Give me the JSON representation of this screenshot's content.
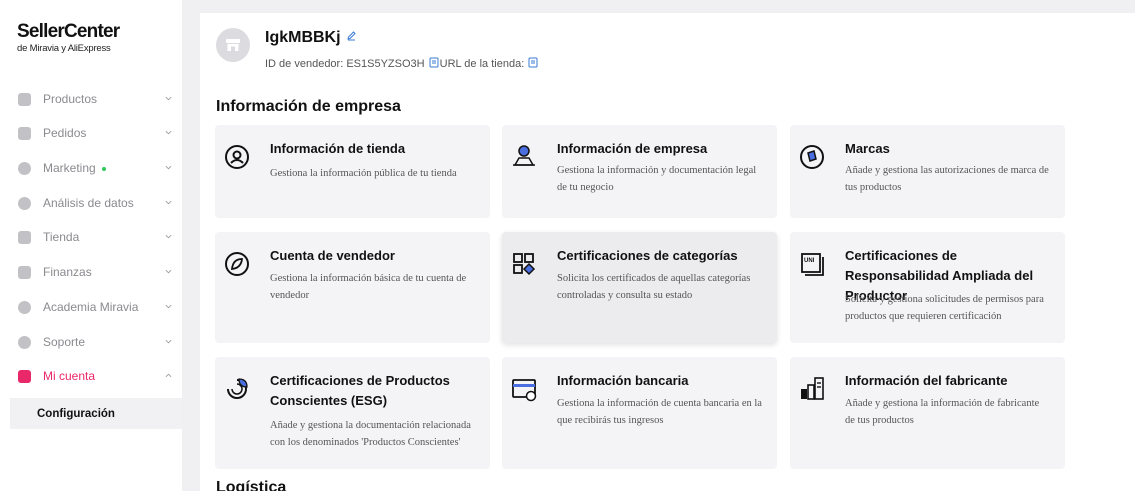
{
  "logo": {
    "title": "SellerCenter",
    "subtitle": "de Miravia y AliExpress"
  },
  "sidebar": {
    "items": [
      {
        "label": "Productos",
        "icon": "box-icon"
      },
      {
        "label": "Pedidos",
        "icon": "orders-icon"
      },
      {
        "label": "Marketing",
        "icon": "marketing-icon"
      },
      {
        "label": "Análisis de datos",
        "icon": "analytics-icon"
      },
      {
        "label": "Tienda",
        "icon": "store-icon"
      },
      {
        "label": "Finanzas",
        "icon": "finance-icon"
      },
      {
        "label": "Academia Miravia",
        "icon": "academy-icon"
      },
      {
        "label": "Soporte",
        "icon": "support-icon"
      },
      {
        "label": "Mi cuenta",
        "icon": "account-icon",
        "active": true
      }
    ],
    "sub_item": "Configuración",
    "accent": "#e9286a"
  },
  "store": {
    "name": "IgkMBBKj",
    "seller_id_label": "ID de vendedor: ES1S5YZSO3H",
    "url_label": "URL de la tienda:"
  },
  "section_title": "Información de empresa",
  "section_title_next": "Logística",
  "cards": [
    {
      "title": "Información de tienda",
      "desc": "Gestiona la información pública de tu tienda",
      "icon": "store-profile-icon"
    },
    {
      "title": "Información de empresa",
      "desc": "Gestiona la información y documentación legal de tu negocio",
      "icon": "company-icon"
    },
    {
      "title": "Marcas",
      "desc": "Añade y gestiona las autorizaciones de marca de tus productos",
      "icon": "brand-icon"
    },
    {
      "title": "Cuenta de vendedor",
      "desc": "Gestiona la información básica de tu cuenta de vendedor",
      "icon": "seller-account-icon"
    },
    {
      "title": "Certificaciones de categorías",
      "desc": "Solicita los certificados de aquellas categorías controladas y consulta su estado",
      "icon": "category-cert-icon"
    },
    {
      "title": "Certificaciones de Responsabilidad Ampliada del Productor",
      "desc": "Solicita y gestiona solicitudes de permisos para productos que requieren certificación",
      "icon": "uni-cert-icon"
    },
    {
      "title": "Certificaciones de Productos Conscientes (ESG)",
      "desc": "Añade y gestiona la documentación relacionada con los denominados 'Productos Conscientes'",
      "icon": "esg-icon"
    },
    {
      "title": "Información bancaria",
      "desc": "Gestiona la información de cuenta bancaria en la que recibirás tus ingresos",
      "icon": "bank-icon"
    },
    {
      "title": "Información del fabricante",
      "desc": "Añade y gestiona la información de fabricante de tus productos",
      "icon": "manufacturer-icon"
    }
  ]
}
